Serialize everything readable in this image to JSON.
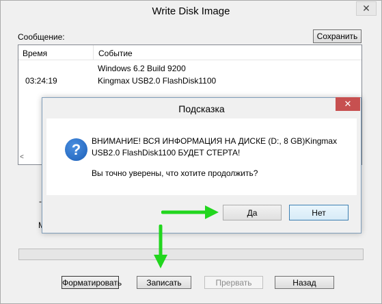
{
  "main_window": {
    "title": "Write Disk Image",
    "close_glyph": "✕",
    "message_label": "Сообщение:",
    "save_label": "Сохранить",
    "log": {
      "columns": [
        "Время",
        "Событие"
      ],
      "rows": [
        {
          "time": "",
          "event": "Windows 6.2 Build 9200"
        },
        {
          "time": "03:24:19",
          "event": "Kingmax USB2.0 FlashDisk1100"
        }
      ],
      "scroll_left": "<",
      "scroll_right": ">"
    },
    "side_chars": [
      "-",
      "M"
    ],
    "progress": {
      "value": 0
    },
    "buttons": {
      "format": "Форматировать",
      "write": "Записать",
      "abort": "Прервать",
      "back": "Назад"
    }
  },
  "dialog": {
    "title": "Подсказка",
    "close_glyph": "✕",
    "icon": "question-icon",
    "icon_glyph": "?",
    "message": "ВНИМАНИЕ! ВСЯ ИНФОРМАЦИЯ НА ДИСКЕ (D:, 8 GB)Kingmax USB2.0 FlashDisk1100 БУДЕТ СТЕРТА!",
    "question": "Вы точно уверены, что хотите продолжить?",
    "yes_label": "Да",
    "no_label": "Нет"
  },
  "colors": {
    "arrow": "#22d61e",
    "dialog_close": "#c75050",
    "icon_blue": "#1c5fb8"
  }
}
